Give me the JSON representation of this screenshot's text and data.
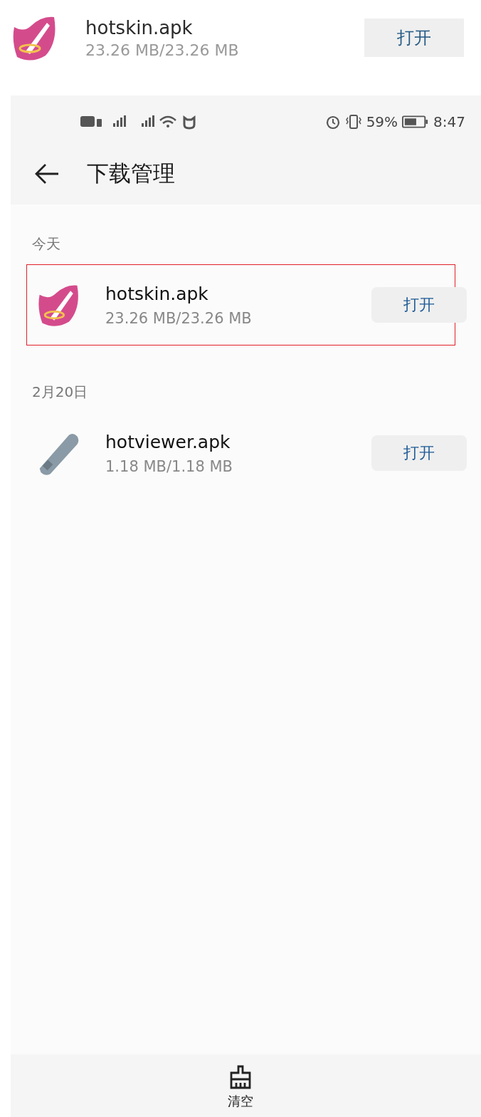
{
  "callout": {
    "kind": "skin",
    "name": "hotskin.apk",
    "size": "23.26 MB/23.26 MB",
    "button": "打开"
  },
  "status_bar": {
    "battery": "59%",
    "time": "8:47"
  },
  "title": "下载管理",
  "sections": [
    {
      "label": "今天",
      "items": [
        {
          "kind": "skin",
          "name": "hotskin.apk",
          "size": "23.26 MB/23.26 MB",
          "button": "打开",
          "highlighted": true
        }
      ]
    },
    {
      "label": "2月20日",
      "items": [
        {
          "kind": "viewer",
          "name": "hotviewer.apk",
          "size": "1.18 MB/1.18 MB",
          "button": "打开"
        }
      ]
    }
  ],
  "bottom_action": "清空"
}
